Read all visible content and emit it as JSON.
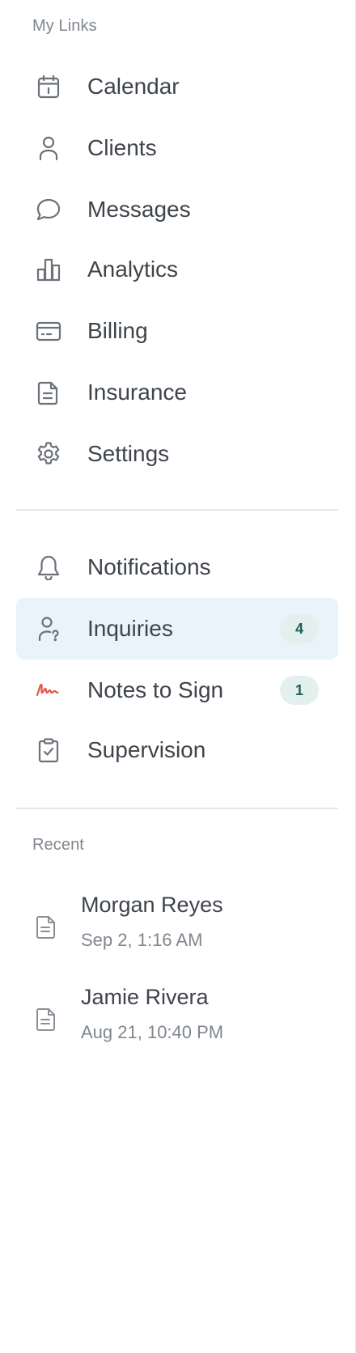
{
  "sidebar": {
    "my_links_label": "My Links",
    "links": [
      {
        "label": "Calendar",
        "icon": "calendar-icon"
      },
      {
        "label": "Clients",
        "icon": "person-icon"
      },
      {
        "label": "Messages",
        "icon": "chat-bubble-icon"
      },
      {
        "label": "Analytics",
        "icon": "bar-chart-icon"
      },
      {
        "label": "Billing",
        "icon": "credit-card-icon"
      },
      {
        "label": "Insurance",
        "icon": "document-icon"
      },
      {
        "label": "Settings",
        "icon": "gear-icon"
      }
    ],
    "secondary": [
      {
        "label": "Notifications",
        "icon": "bell-icon"
      },
      {
        "label": "Inquiries",
        "icon": "person-question-icon",
        "badge": "4",
        "active": true
      },
      {
        "label": "Notes to Sign",
        "icon": "signature-icon",
        "badge": "1"
      },
      {
        "label": "Supervision",
        "icon": "clipboard-check-icon"
      }
    ],
    "recent_label": "Recent",
    "recent": [
      {
        "name": "Morgan Reyes",
        "date": "Sep 2, 1:16 AM",
        "icon": "file-icon"
      },
      {
        "name": "Jamie Rivera",
        "date": "Aug 21, 10:40 PM",
        "icon": "file-icon"
      }
    ]
  },
  "colors": {
    "active_background": "#e8f3fa",
    "badge_background": "#e3f0ee",
    "badge_text": "#1f5e58",
    "signature_icon": "#e5534b",
    "icon_gray": "#6b7178"
  }
}
